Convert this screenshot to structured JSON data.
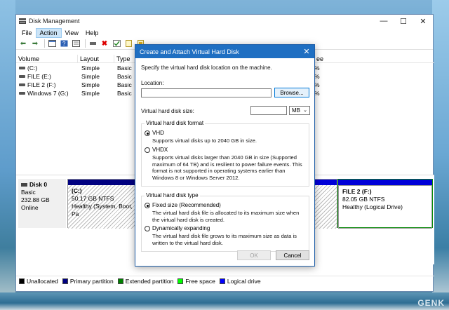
{
  "window": {
    "title": "Disk Management",
    "menu": [
      "File",
      "Action",
      "View",
      "Help"
    ],
    "active_menu": "Action",
    "controls": {
      "minimize": "—",
      "maximize": "☐",
      "close": "✕"
    }
  },
  "toolbar_icons": [
    "back-arrow-icon",
    "forward-arrow-icon",
    "console-tree-icon",
    "help-icon",
    "properties-icon",
    "connect-icon",
    "delete-icon",
    "checkmark-icon",
    "new-icon",
    "import-icon"
  ],
  "volume_list": {
    "columns": [
      "Volume",
      "Layout",
      "Type",
      "ee"
    ],
    "rows": [
      {
        "volume": "(C:)",
        "layout": "Simple",
        "type": "Basic",
        "right": "%"
      },
      {
        "volume": "FILE (E:)",
        "layout": "Simple",
        "type": "Basic",
        "right": "%"
      },
      {
        "volume": "FILE 2 (F:)",
        "layout": "Simple",
        "type": "Basic",
        "right": "%"
      },
      {
        "volume": "Windows 7 (G:)",
        "layout": "Simple",
        "type": "Basic",
        "right": "%"
      }
    ]
  },
  "disk0": {
    "name": "Disk 0",
    "type": "Basic",
    "size": "232.88 GB",
    "status": "Online",
    "partitions": [
      {
        "label": "(C:)",
        "size": "50.17 GB NTFS",
        "status": "Healthy (System, Boot, Pa"
      },
      {
        "label": "FILE 2  (F:)",
        "size": "82.05 GB NTFS",
        "status": "Healthy (Logical Drive)"
      }
    ]
  },
  "legend": [
    {
      "label": "Unallocated",
      "color": "#000000"
    },
    {
      "label": "Primary partition",
      "color": "#000080"
    },
    {
      "label": "Extended partition",
      "color": "#008000"
    },
    {
      "label": "Free space",
      "color": "#00ff00"
    },
    {
      "label": "Logical drive",
      "color": "#0000ff"
    }
  ],
  "dialog": {
    "title": "Create and Attach Virtual Hard Disk",
    "close": "✕",
    "instruction": "Specify the virtual hard disk location on the machine.",
    "location_label": "Location:",
    "location_value": "",
    "browse_label": "Browse...",
    "size_label": "Virtual hard disk size:",
    "size_value": "",
    "size_unit": "MB",
    "format_group": "Virtual hard disk format",
    "format_vhd": "VHD",
    "format_vhd_desc": "Supports virtual disks up to 2040 GB in size.",
    "format_vhdx": "VHDX",
    "format_vhdx_desc": "Supports virtual disks larger than 2040 GB in size (Supported maximum of 64 TB) and is resilient to power failure events. This format is not supported in operating systems earlier than Windows 8 or Windows Server 2012.",
    "type_group": "Virtual hard disk type",
    "type_fixed": "Fixed size (Recommended)",
    "type_fixed_desc": "The virtual hard disk file is allocated to its maximum size when the virtual hard disk is created.",
    "type_dynamic": "Dynamically expanding",
    "type_dynamic_desc": "The virtual hard disk file grows to its maximum size as data is written to the virtual hard disk.",
    "ok_label": "OK",
    "cancel_label": "Cancel"
  },
  "watermark": "GENK"
}
